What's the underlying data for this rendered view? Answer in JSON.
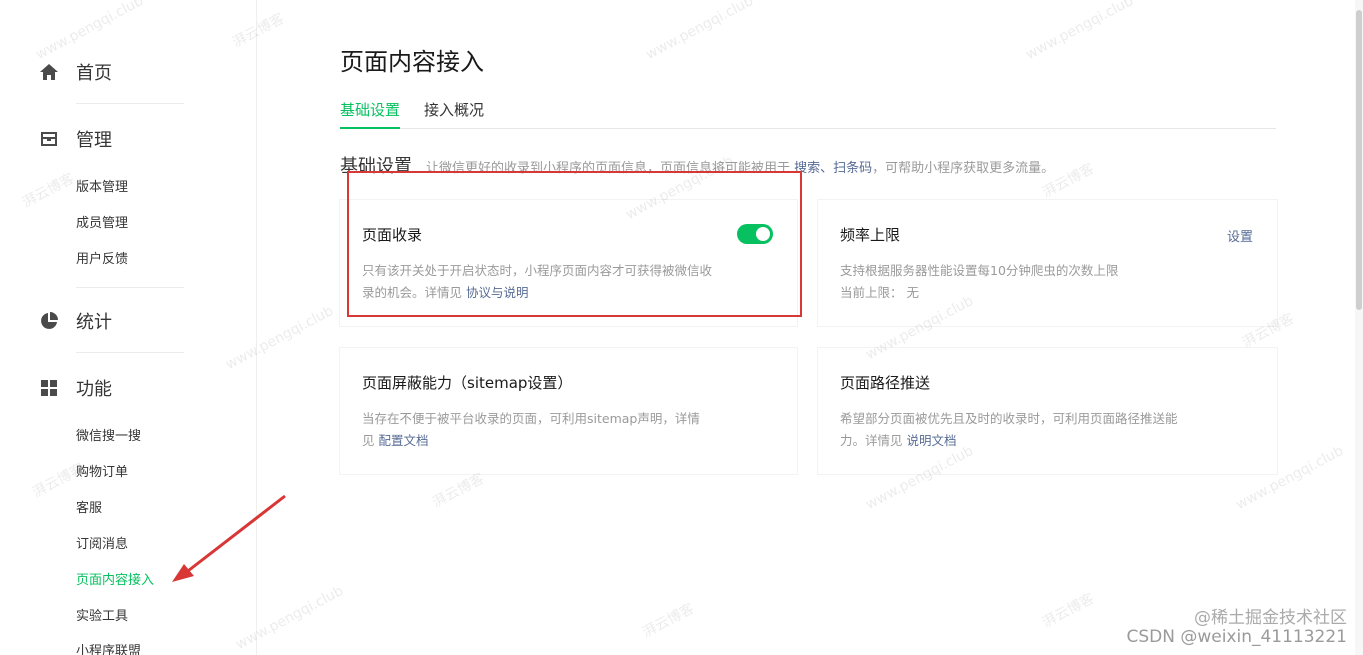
{
  "sidebar": {
    "home": {
      "label": "首页",
      "icon": "home-icon"
    },
    "manage": {
      "label": "管理",
      "icon": "inbox-icon",
      "items": [
        "版本管理",
        "成员管理",
        "用户反馈"
      ]
    },
    "stats": {
      "label": "统计",
      "icon": "pie-chart-icon"
    },
    "features": {
      "label": "功能",
      "icon": "grid-icon",
      "items": [
        "微信搜一搜",
        "购物订单",
        "客服",
        "订阅消息",
        "页面内容接入",
        "实验工具",
        "小程序联盟"
      ],
      "active": "页面内容接入"
    }
  },
  "main": {
    "title": "页面内容接入",
    "tabs": [
      {
        "label": "基础设置",
        "active": true
      },
      {
        "label": "接入概况",
        "active": false
      }
    ],
    "section": {
      "title": "基础设置",
      "desc_prefix": "让微信更好的收录到小程序的页面信息，页面信息将可能被用于",
      "desc_highlight": "搜索、扫条码",
      "desc_suffix": "，可帮助小程序获取更多流量。"
    },
    "cards": {
      "page_index": {
        "title": "页面收录",
        "desc": "只有该开关处于开启状态时，小程序页面内容才可获得被微信收录的机会。详情见",
        "link": "协议与说明",
        "toggle_on": true
      },
      "rate_limit": {
        "title": "频率上限",
        "action": "设置",
        "desc": "支持根据服务器性能设置每10分钟爬虫的次数上限",
        "current_label": "当前上限：",
        "current_value": "无"
      },
      "sitemap": {
        "title": "页面屏蔽能力（sitemap设置）",
        "desc": "当存在不便于被平台收录的页面，可利用sitemap声明，详情见",
        "link": "配置文档"
      },
      "path_push": {
        "title": "页面路径推送",
        "desc": "希望部分页面被优先且及时的收录时，可利用页面路径推送能力。详情见",
        "link": "说明文档"
      }
    }
  },
  "watermark": {
    "text1": "湃云博客",
    "text2": "www.pengqi.club"
  },
  "corner_mark": "@稀土掘金技术社区",
  "csdn_mark": "CSDN @weixin_41113221",
  "colors": {
    "accent": "#07c160",
    "link": "#576b95",
    "highlight_border": "#d93636"
  }
}
